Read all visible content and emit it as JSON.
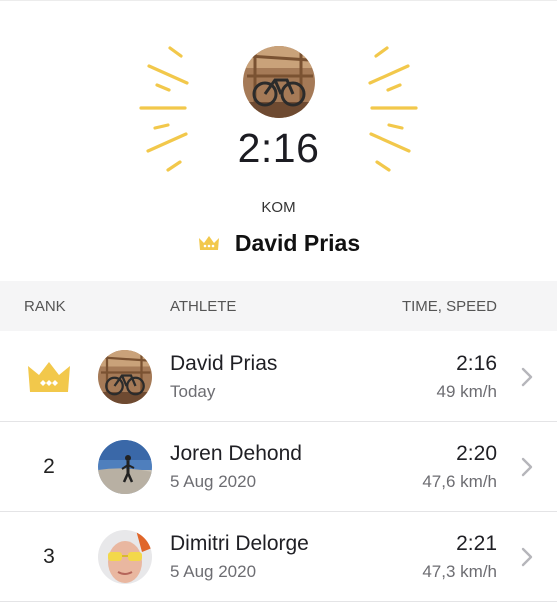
{
  "colors": {
    "accent": "#f2c84b",
    "header_bg": "#f5f5f6"
  },
  "segment": {
    "best_time": "2:16",
    "title_label": "KOM",
    "holder_name": "David Prias",
    "holder_icon": "crown-icon"
  },
  "leaderboard": {
    "columns": {
      "rank": "RANK",
      "athlete": "ATHLETE",
      "time_speed": "TIME, SPEED"
    },
    "rows": [
      {
        "rank": "",
        "rank_icon": "crown-icon",
        "name": "David Prias",
        "date": "Today",
        "time": "2:16",
        "speed": "49 km/h",
        "avatar": "bike-photo-avatar"
      },
      {
        "rank": "2",
        "name": "Joren Dehond",
        "date": "5 Aug 2020",
        "time": "2:20",
        "speed": "47,6 km/h",
        "avatar": "beach-photo-avatar"
      },
      {
        "rank": "3",
        "name": "Dimitri Delorge",
        "date": "5 Aug 2020",
        "time": "2:21",
        "speed": "47,3 km/h",
        "avatar": "glasses-photo-avatar"
      }
    ]
  }
}
